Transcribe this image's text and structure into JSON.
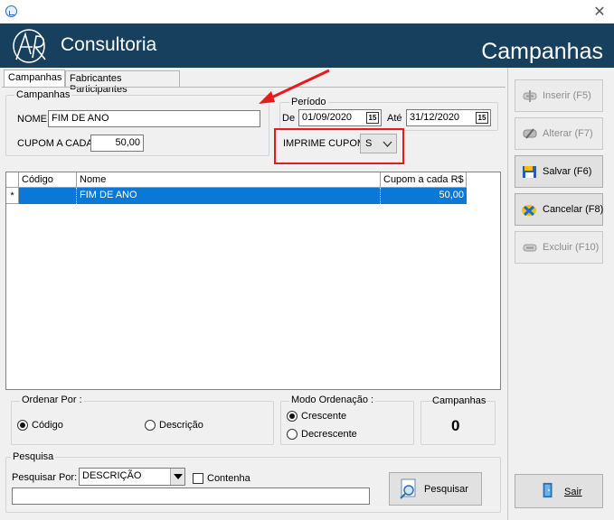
{
  "window": {
    "close_glyph": "✕",
    "app_icon": "chart-app-icon"
  },
  "header": {
    "logo_text": "Consultoria",
    "logo_mark": "AR",
    "title": "Campanhas",
    "bg_color": "#16405e"
  },
  "tabs": [
    {
      "label": "Campanhas",
      "active": true
    },
    {
      "label": "Fabricantes Participantes",
      "active": false
    }
  ],
  "campanhas_group": {
    "label": "Campanhas",
    "nome_label": "NOME",
    "nome_value": "FIM DE ANO",
    "cupom_label": "CUPOM A CADA",
    "cupom_value": "50,00"
  },
  "periodo_group": {
    "label": "Período",
    "de_label": "De",
    "de_value": "01/09/2020",
    "ate_label": "Até",
    "ate_value": "31/12/2020",
    "cal_glyph": "15"
  },
  "imprime": {
    "label": "IMPRIME CUPOM",
    "value": "S"
  },
  "grid": {
    "columns": [
      "Código",
      "Nome",
      "Cupom a cada R$"
    ],
    "rows": [
      {
        "marker": "*",
        "codigo": "",
        "nome": "FIM DE ANO",
        "cupom": "50,00"
      }
    ]
  },
  "ordenar": {
    "label": "Ordenar Por :",
    "opt1": "Código",
    "opt2": "Descrição",
    "selected": "Código"
  },
  "modo": {
    "label": "Modo Ordenação :",
    "opt1": "Crescente",
    "opt2": "Decrescente",
    "selected": "Crescente"
  },
  "contador": {
    "label": "Campanhas",
    "value": "0"
  },
  "pesquisa": {
    "label": "Pesquisa",
    "por_label": "Pesquisar Por:",
    "por_value": "DESCRIÇÃO",
    "contenha_label": "Contenha",
    "search_value": "",
    "button_label": "Pesquisar"
  },
  "side_buttons": {
    "inserir": "Inserir  (F5)",
    "alterar": "Alterar  (F7)",
    "salvar": "Salvar (F6)",
    "cancelar": "Cancelar (F8)",
    "excluir": "Excluir  (F10)",
    "sair": "Sair"
  },
  "colors": {
    "selection": "#0a78d7",
    "highlight_box": "#e51c1c",
    "arrow": "#e51c1c"
  }
}
